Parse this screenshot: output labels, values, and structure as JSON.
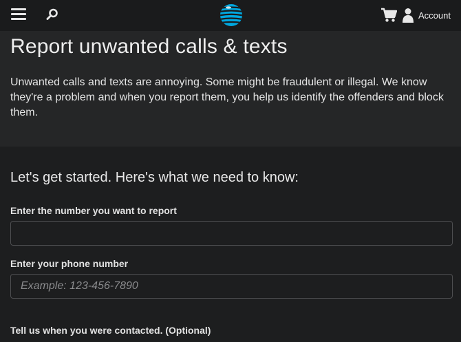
{
  "header": {
    "account_label": "Account",
    "icons": [
      "menu-icon",
      "search-icon",
      "att-globe-logo",
      "cart-icon",
      "person-icon"
    ],
    "logo_color": "#00a8e0"
  },
  "hero": {
    "title": "Report unwanted calls & texts",
    "description": "Unwanted calls and texts are annoying. Some might be fraudulent or illegal. We know they're a problem and when you report them, you help us identify the offenders and block them."
  },
  "form": {
    "heading": "Let's get started. Here's what we need to know:",
    "fields": [
      {
        "label": "Enter the number you want to report",
        "value": "",
        "placeholder": ""
      },
      {
        "label": "Enter your phone number",
        "value": "",
        "placeholder": "Example: 123-456-7890"
      }
    ],
    "contact_time_label": "Tell us when you were contacted. (Optional)"
  }
}
